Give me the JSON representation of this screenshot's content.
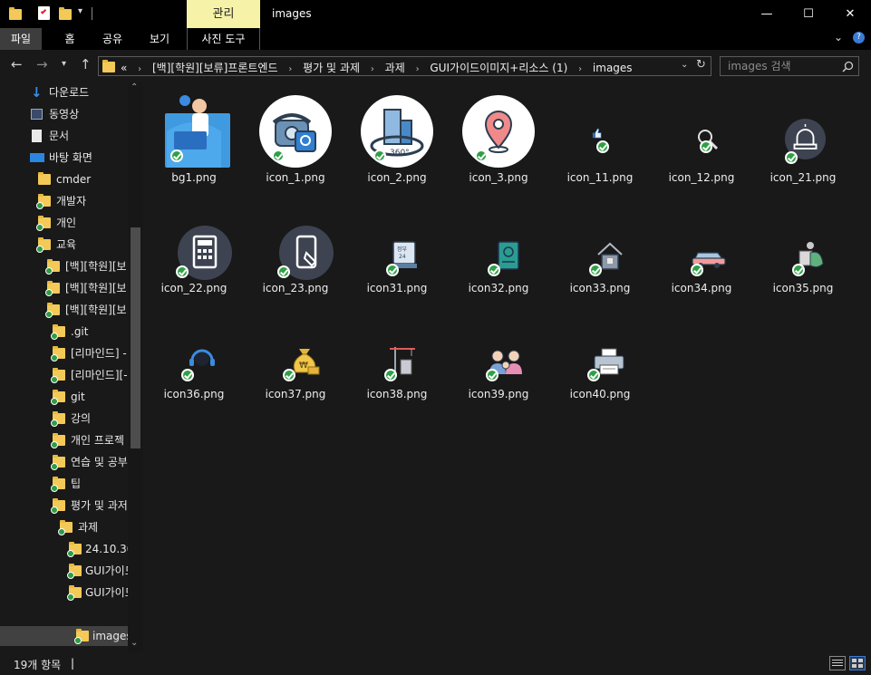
{
  "window": {
    "contextual_tab": "관리",
    "title": "images",
    "minimize_glyph": "—",
    "maximize_glyph": "☐",
    "close_glyph": "✕"
  },
  "ribbon": {
    "tabs": [
      {
        "label": "파일"
      },
      {
        "label": "홈"
      },
      {
        "label": "공유"
      },
      {
        "label": "보기"
      },
      {
        "label": "사진 도구"
      }
    ]
  },
  "address": {
    "overflow": "«",
    "crumbs": [
      "[백][학원][보류]프론트엔드",
      "평가 및 과제",
      "과제",
      "GUI가이드이미지+리소스 (1)",
      "images"
    ]
  },
  "search": {
    "placeholder": "images 검색"
  },
  "nav": {
    "items": [
      {
        "label": "다운로드"
      },
      {
        "label": "동영상"
      },
      {
        "label": "문서"
      },
      {
        "label": "바탕 화면"
      },
      {
        "label": "cmder"
      },
      {
        "label": "개발자"
      },
      {
        "label": "개인"
      },
      {
        "label": "교육"
      },
      {
        "label": "[백][학원][보"
      },
      {
        "label": "[백][학원][보"
      },
      {
        "label": "[백][학원][보"
      },
      {
        "label": ".git"
      },
      {
        "label": "[리마인드] -"
      },
      {
        "label": "[리마인드][-"
      },
      {
        "label": "git"
      },
      {
        "label": "강의"
      },
      {
        "label": "개인 프로젝"
      },
      {
        "label": "연습 및 공부"
      },
      {
        "label": "팁"
      },
      {
        "label": "평가 및 과저"
      },
      {
        "label": "과제"
      },
      {
        "label": "24.10.30"
      },
      {
        "label": "GUI가이드"
      },
      {
        "label": "GUI가이드"
      },
      {
        "label": "images"
      }
    ]
  },
  "files": [
    {
      "name": "bg1.png",
      "icon": "person-laptop-illustration"
    },
    {
      "name": "icon_1.png",
      "icon": "telephone-search-icon"
    },
    {
      "name": "icon_2.png",
      "icon": "building-360-icon"
    },
    {
      "name": "icon_3.png",
      "icon": "map-pin-icon"
    },
    {
      "name": "icon_11.png",
      "icon": "thumbs-up-icon"
    },
    {
      "name": "icon_12.png",
      "icon": "magnifier-icon"
    },
    {
      "name": "icon_21.png",
      "icon": "siren-icon"
    },
    {
      "name": "icon_22.png",
      "icon": "calculator-icon"
    },
    {
      "name": "icon_23.png",
      "icon": "phone-touch-icon"
    },
    {
      "name": "icon31.png",
      "icon": "calendar-24-icon",
      "badge": "정부 24"
    },
    {
      "name": "icon32.png",
      "icon": "passport-icon"
    },
    {
      "name": "icon33.png",
      "icon": "house-icon"
    },
    {
      "name": "icon34.png",
      "icon": "car-icon"
    },
    {
      "name": "icon35.png",
      "icon": "recycle-bag-icon"
    },
    {
      "name": "icon36.png",
      "icon": "headset-icon"
    },
    {
      "name": "icon37.png",
      "icon": "money-bag-icon",
      "badge": "₩"
    },
    {
      "name": "icon38.png",
      "icon": "crane-building-icon"
    },
    {
      "name": "icon39.png",
      "icon": "family-icon"
    },
    {
      "name": "icon40.png",
      "icon": "printer-icon"
    }
  ],
  "status": {
    "count": "19개 항목",
    "caret": "|"
  }
}
